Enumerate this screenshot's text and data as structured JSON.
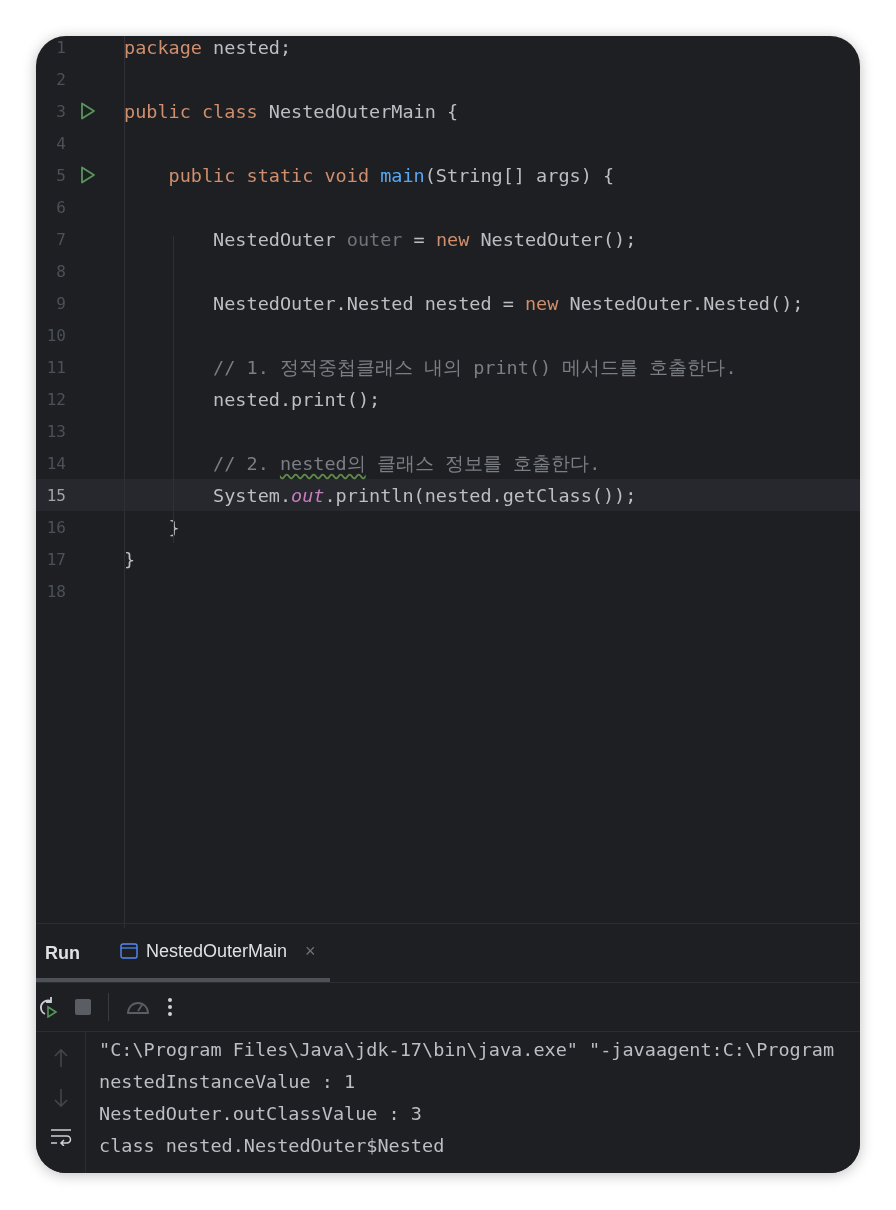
{
  "editor": {
    "lines": [
      {
        "number": "1",
        "runnable": false,
        "current": false,
        "tokens": [
          {
            "text": "package",
            "kind": "keyword"
          },
          {
            "text": " nested;",
            "kind": "plain"
          }
        ]
      },
      {
        "number": "2",
        "runnable": false,
        "current": false
      },
      {
        "number": "3",
        "runnable": true,
        "current": false,
        "tokens": [
          {
            "text": "public class",
            "kind": "keyword"
          },
          {
            "text": " NestedOuterMain {",
            "kind": "plain"
          }
        ]
      },
      {
        "number": "4",
        "runnable": false,
        "current": false
      },
      {
        "number": "5",
        "runnable": true,
        "current": false,
        "tokens": [
          {
            "text": "    public static void ",
            "kind": "keyword"
          },
          {
            "text": "main",
            "kind": "method"
          },
          {
            "text": "(String[] args) {",
            "kind": "plain"
          }
        ]
      },
      {
        "number": "6",
        "runnable": false,
        "current": false
      },
      {
        "number": "7",
        "runnable": false,
        "current": false,
        "tokens": [
          {
            "text": "        NestedOuter ",
            "kind": "plain"
          },
          {
            "text": "outer",
            "kind": "unused"
          },
          {
            "text": " = ",
            "kind": "plain"
          },
          {
            "text": "new",
            "kind": "keyword"
          },
          {
            "text": " NestedOuter();",
            "kind": "plain"
          }
        ]
      },
      {
        "number": "8",
        "runnable": false,
        "current": false
      },
      {
        "number": "9",
        "runnable": false,
        "current": false,
        "tokens": [
          {
            "text": "        NestedOuter.Nested nested = ",
            "kind": "plain"
          },
          {
            "text": "new",
            "kind": "keyword"
          },
          {
            "text": " NestedOuter.Nested();",
            "kind": "plain"
          }
        ]
      },
      {
        "number": "10",
        "runnable": false,
        "current": false
      },
      {
        "number": "11",
        "runnable": false,
        "current": false,
        "tokens": [
          {
            "text": "        // 1. 정적중첩클래스 내의 print() 메서드를 호출한다.",
            "kind": "comment"
          }
        ]
      },
      {
        "number": "12",
        "runnable": false,
        "current": false,
        "tokens": [
          {
            "text": "        nested.print();",
            "kind": "plain"
          }
        ]
      },
      {
        "number": "13",
        "runnable": false,
        "current": false
      },
      {
        "number": "14",
        "runnable": false,
        "current": false,
        "tokens": [
          {
            "text": "        // 2. ",
            "kind": "comment"
          },
          {
            "text": "nested의",
            "kind": "typo"
          },
          {
            "text": " 클래스 정보를 호출한다.",
            "kind": "comment"
          }
        ]
      },
      {
        "number": "15",
        "runnable": false,
        "current": true,
        "tokens": [
          {
            "text": "        System.",
            "kind": "plain"
          },
          {
            "text": "out",
            "kind": "static"
          },
          {
            "text": ".println(nested.getClass());",
            "kind": "plain"
          }
        ]
      },
      {
        "number": "16",
        "runnable": false,
        "current": false,
        "tokens": [
          {
            "text": "    }",
            "kind": "plain"
          }
        ]
      },
      {
        "number": "17",
        "runnable": false,
        "current": false,
        "tokens": [
          {
            "text": "}",
            "kind": "plain"
          }
        ]
      },
      {
        "number": "18",
        "runnable": false,
        "current": false
      }
    ]
  },
  "run_panel": {
    "title": "Run",
    "tabs": [
      {
        "label": "NestedOuterMain",
        "selected": true,
        "close": "×"
      }
    ],
    "console": {
      "lines": [
        "\"C:\\Program Files\\Java\\jdk-17\\bin\\java.exe\" \"-javaagent:C:\\Program",
        "nestedInstanceValue : 1",
        "NestedOuter.outClassValue : 3",
        "class nested.NestedOuter$Nested"
      ]
    }
  }
}
